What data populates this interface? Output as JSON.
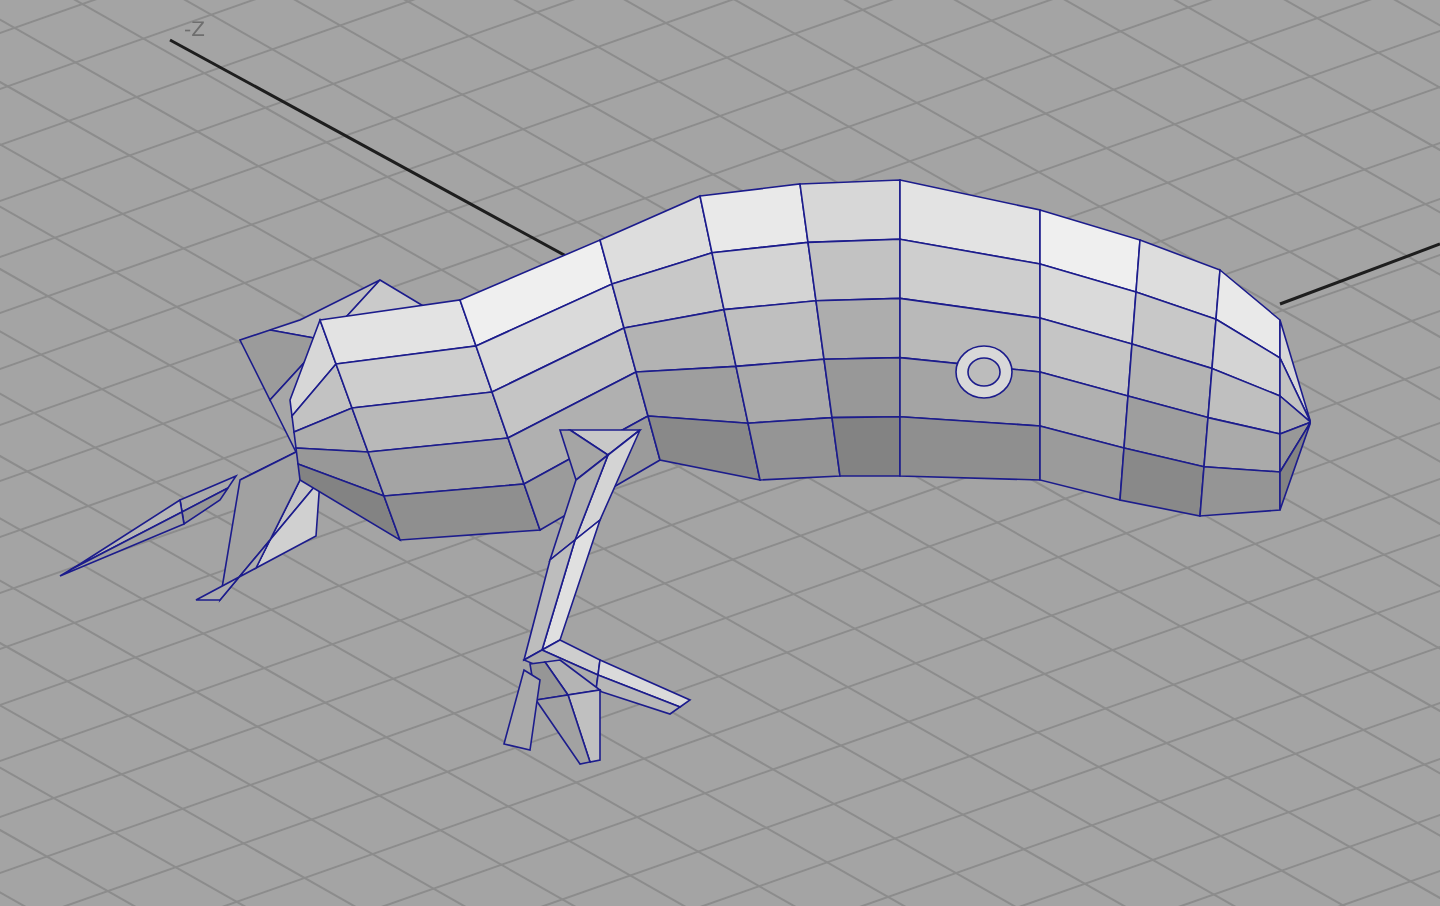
{
  "viewport": {
    "axis_label": "-Z"
  }
}
